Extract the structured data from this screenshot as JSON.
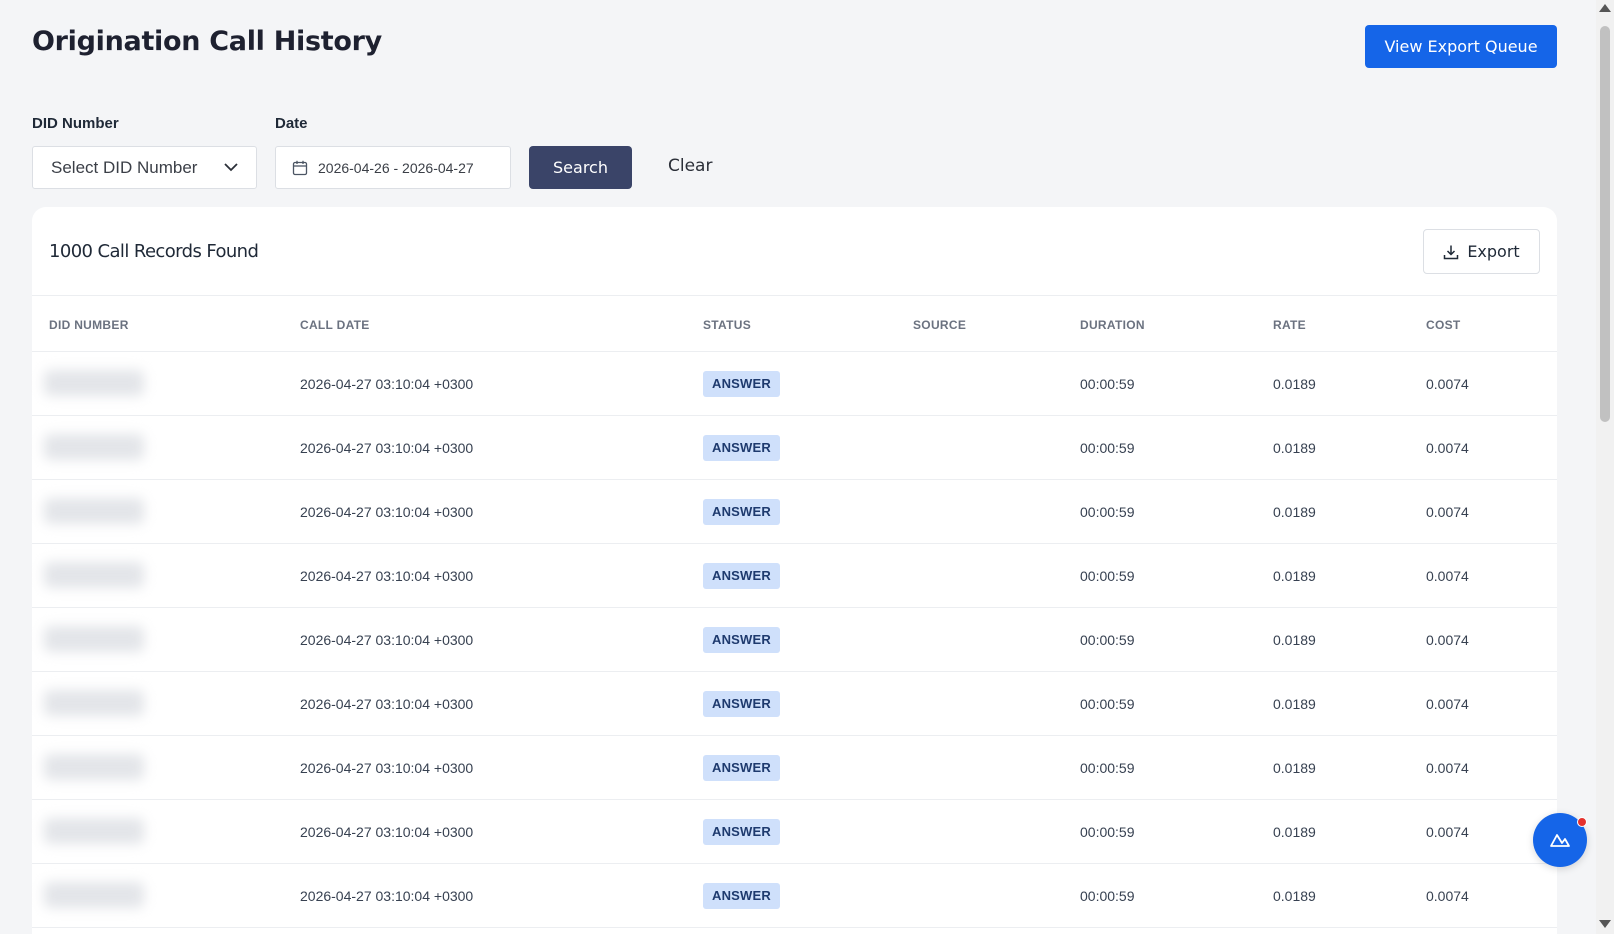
{
  "page": {
    "title": "Origination Call History",
    "export_queue_label": "View Export Queue"
  },
  "filters": {
    "did_label": "DID Number",
    "did_placeholder": "Select DID Number",
    "date_label": "Date",
    "date_value": "2026-04-26 - 2026-04-27",
    "search_label": "Search",
    "clear_label": "Clear"
  },
  "results": {
    "summary": "1000 Call Records Found",
    "export_label": "Export"
  },
  "table": {
    "columns": [
      "DID NUMBER",
      "CALL DATE",
      "STATUS",
      "SOURCE",
      "DURATION",
      "RATE",
      "COST"
    ],
    "rows": [
      {
        "call_date": "2026-04-27 03:10:04 +0300",
        "status": "ANSWER",
        "source": "",
        "duration": "00:00:59",
        "rate": "0.0189",
        "cost": "0.0074"
      },
      {
        "call_date": "2026-04-27 03:10:04 +0300",
        "status": "ANSWER",
        "source": "",
        "duration": "00:00:59",
        "rate": "0.0189",
        "cost": "0.0074"
      },
      {
        "call_date": "2026-04-27 03:10:04 +0300",
        "status": "ANSWER",
        "source": "",
        "duration": "00:00:59",
        "rate": "0.0189",
        "cost": "0.0074"
      },
      {
        "call_date": "2026-04-27 03:10:04 +0300",
        "status": "ANSWER",
        "source": "",
        "duration": "00:00:59",
        "rate": "0.0189",
        "cost": "0.0074"
      },
      {
        "call_date": "2026-04-27 03:10:04 +0300",
        "status": "ANSWER",
        "source": "",
        "duration": "00:00:59",
        "rate": "0.0189",
        "cost": "0.0074"
      },
      {
        "call_date": "2026-04-27 03:10:04 +0300",
        "status": "ANSWER",
        "source": "",
        "duration": "00:00:59",
        "rate": "0.0189",
        "cost": "0.0074"
      },
      {
        "call_date": "2026-04-27 03:10:04 +0300",
        "status": "ANSWER",
        "source": "",
        "duration": "00:00:59",
        "rate": "0.0189",
        "cost": "0.0074"
      },
      {
        "call_date": "2026-04-27 03:10:04 +0300",
        "status": "ANSWER",
        "source": "",
        "duration": "00:00:59",
        "rate": "0.0189",
        "cost": "0.0074"
      },
      {
        "call_date": "2026-04-27 03:10:04 +0300",
        "status": "ANSWER",
        "source": "",
        "duration": "00:00:59",
        "rate": "0.0189",
        "cost": "0.0074"
      }
    ]
  },
  "icons": {
    "dropdown": "chevron-down-icon",
    "date": "calendar-icon",
    "export": "download-icon",
    "chat": "chat-widget-icon"
  },
  "colors": {
    "primary": "#1565e8",
    "search_button": "#3a4468",
    "badge_bg": "#cfe0fb",
    "notification_dot": "#e5312d"
  }
}
